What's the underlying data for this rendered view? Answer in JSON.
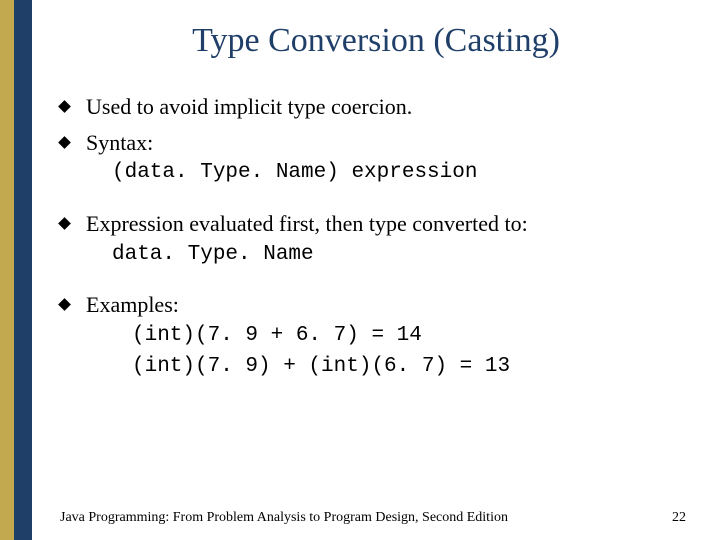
{
  "slide": {
    "title": "Type Conversion (Casting)",
    "bullets": {
      "b1": "Used to avoid implicit type coercion.",
      "b2": "Syntax:",
      "b2_code": "(data. Type. Name) expression",
      "b3_pre": "Expression evaluated first, then type converted to:",
      "b3_code": "data. Type. Name",
      "b4": "Examples:",
      "ex1": "(int)(7. 9 + 6. 7) = 14",
      "ex2": "(int)(7. 9) + (int)(6. 7) = 13"
    },
    "footer_text": "Java Programming: From Problem Analysis to Program Design, Second Edition",
    "page_number": "22"
  }
}
